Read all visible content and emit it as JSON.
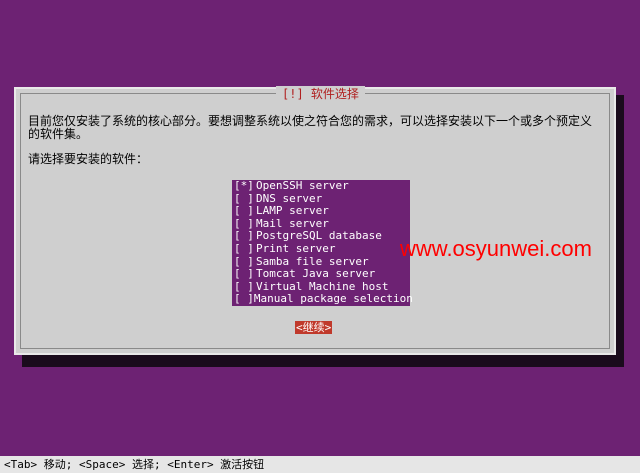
{
  "dialog": {
    "title": "[!] 软件选择",
    "description": "目前您仅安装了系统的核心部分。要想调整系统以使之符合您的需求，可以选择安装以下一个或多个预定义的软件集。",
    "prompt": "请选择要安装的软件：",
    "items": [
      {
        "checkbox": "[*]",
        "label": "OpenSSH server"
      },
      {
        "checkbox": "[ ]",
        "label": "DNS server"
      },
      {
        "checkbox": "[ ]",
        "label": "LAMP server"
      },
      {
        "checkbox": "[ ]",
        "label": "Mail server"
      },
      {
        "checkbox": "[ ]",
        "label": "PostgreSQL database"
      },
      {
        "checkbox": "[ ]",
        "label": "Print server"
      },
      {
        "checkbox": "[ ]",
        "label": "Samba file server"
      },
      {
        "checkbox": "[ ]",
        "label": "Tomcat Java server"
      },
      {
        "checkbox": "[ ]",
        "label": "Virtual Machine host"
      },
      {
        "checkbox": "[ ]",
        "label": "Manual package selection"
      }
    ],
    "continue_label": "<继续>"
  },
  "watermark": "www.osyunwei.com",
  "statusbar": "<Tab> 移动; <Space> 选择; <Enter> 激活按钮",
  "colors": {
    "background": "#6d2273",
    "dialog": "#cfcfcf",
    "title_text": "#b02020",
    "button": "#c0392b",
    "watermark": "#ff0000"
  }
}
